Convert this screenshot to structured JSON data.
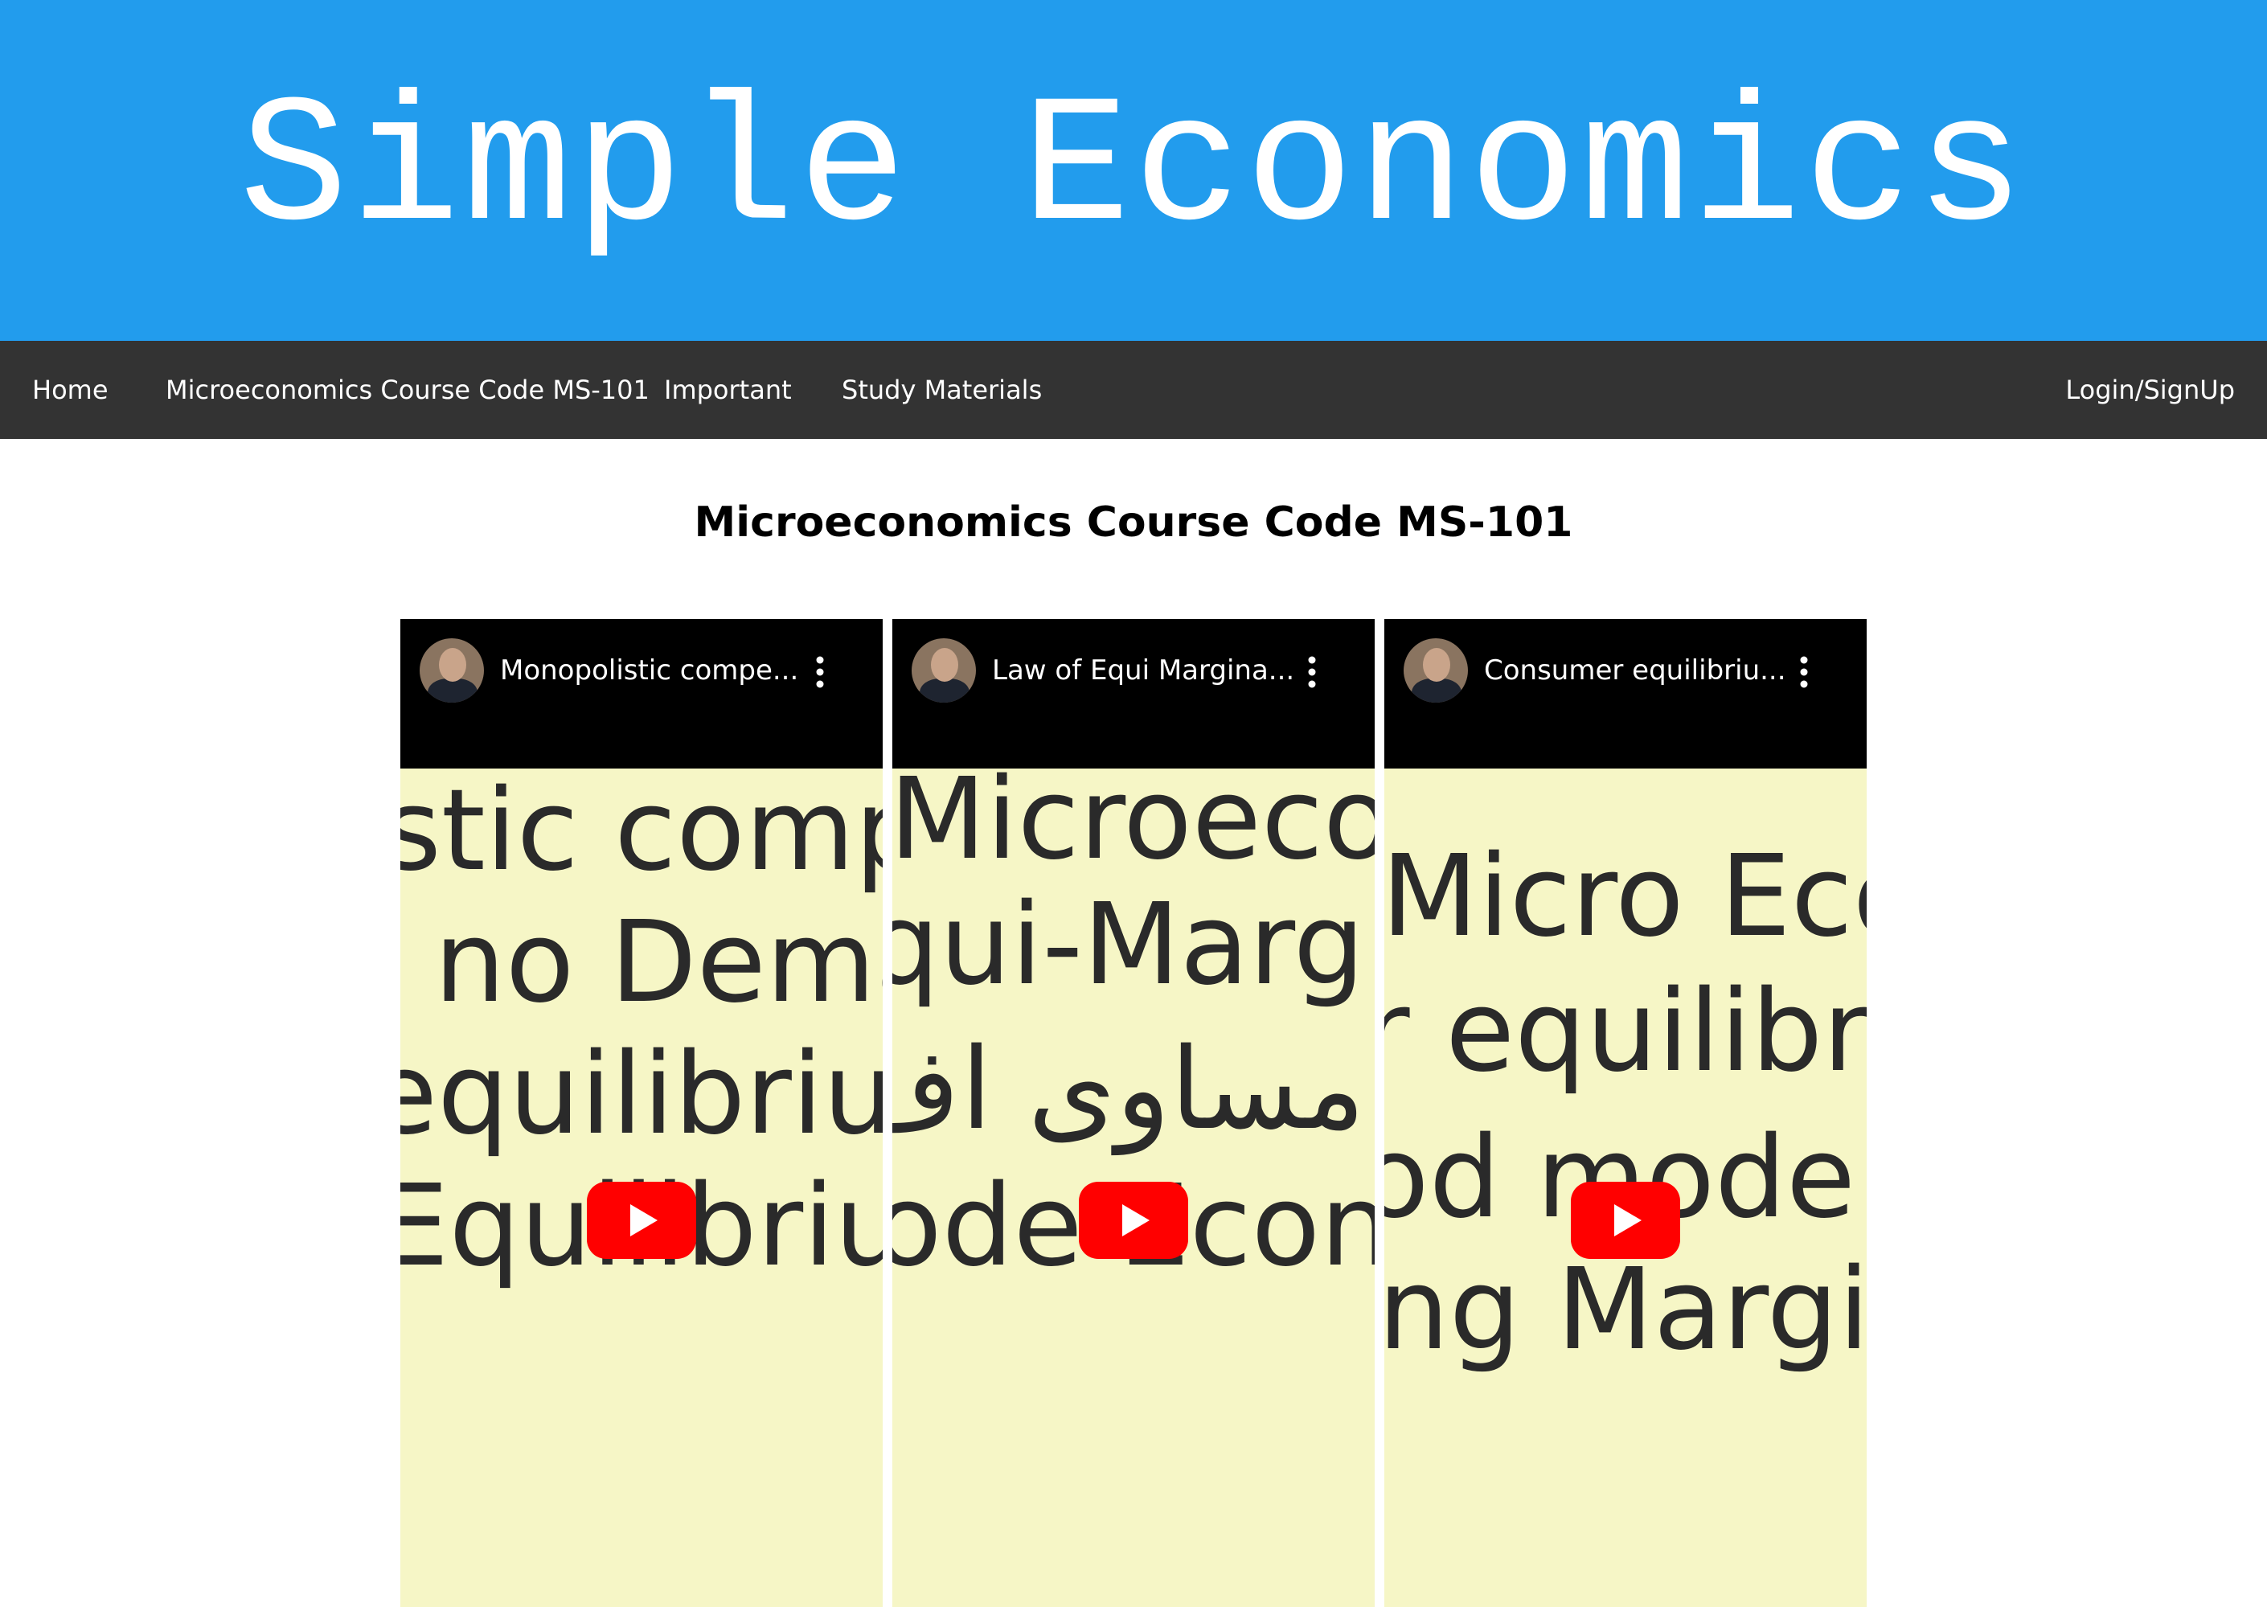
{
  "banner": {
    "title": "Simple Economics",
    "background": "#229ced"
  },
  "nav": {
    "items": [
      {
        "label": "Home"
      },
      {
        "label": "Microeconomics Course Code MS-101"
      },
      {
        "label": "Important"
      },
      {
        "label": "Study Materials"
      }
    ],
    "login_label": "Login/SignUp",
    "background": "#333333"
  },
  "main": {
    "heading": "Microeconomics Course Code MS-101"
  },
  "videos": [
    {
      "title": "Monopolistic compe...",
      "thumbnail_lines": [
        "stic compe",
        "no Dema",
        "equilibrium",
        "Equilibrium"
      ],
      "icons": [
        "channel-avatar",
        "more-vert-icon",
        "youtube-play-icon"
      ]
    },
    {
      "title": "Law of Equi Margina...",
      "thumbnail_lines": [
        "Microeco",
        "qui-Margin",
        "ن مساوی اف",
        "ode Econ"
      ],
      "icons": [
        "channel-avatar",
        "more-vert-icon",
        "youtube-play-icon"
      ]
    },
    {
      "title": "Consumer equilibriu...",
      "thumbnail_lines": [
        "Micro Eco",
        "r equilibr",
        "od mode",
        "ng Margi"
      ],
      "icons": [
        "channel-avatar",
        "more-vert-icon",
        "youtube-play-icon"
      ]
    }
  ],
  "colors": {
    "thumbnail_background": "#f6f6c6",
    "play_button": "#ff0000"
  }
}
